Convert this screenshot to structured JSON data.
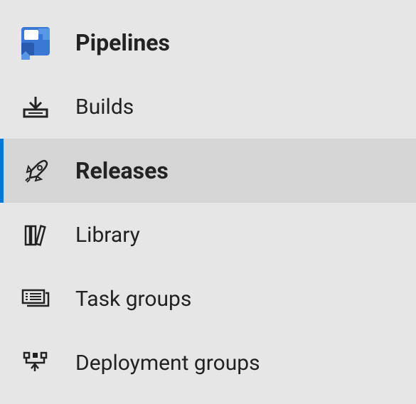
{
  "sidebar": {
    "items": [
      {
        "label": "Pipelines",
        "icon": "pipelines-icon",
        "header": true,
        "selected": false
      },
      {
        "label": "Builds",
        "icon": "builds-icon",
        "header": false,
        "selected": false
      },
      {
        "label": "Releases",
        "icon": "releases-icon",
        "header": false,
        "selected": true
      },
      {
        "label": "Library",
        "icon": "library-icon",
        "header": false,
        "selected": false
      },
      {
        "label": "Task groups",
        "icon": "task-groups-icon",
        "header": false,
        "selected": false
      },
      {
        "label": "Deployment groups",
        "icon": "deployment-groups-icon",
        "header": false,
        "selected": false
      }
    ]
  }
}
